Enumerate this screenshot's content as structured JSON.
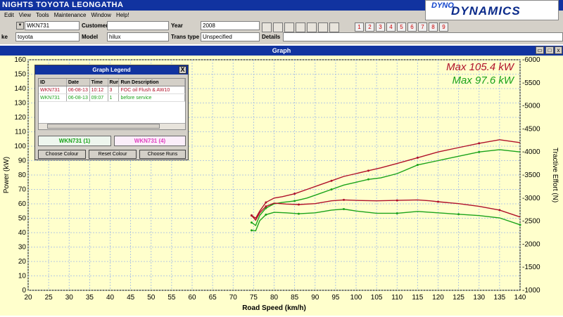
{
  "app": {
    "title": "NIGHTS TOYOTA LEONGATHA",
    "menu": [
      "Edit",
      "View",
      "Tools",
      "Maintenance",
      "Window",
      "Help!"
    ],
    "logo_top": "DYNO",
    "logo_main": "DYNAMICS"
  },
  "vehicle": {
    "rego_value": "WKN731",
    "customer_label": "Customer",
    "customer_value": "",
    "year_label": "Year",
    "year_value": "2008",
    "make_label": "ke",
    "make_value": "toyota",
    "model_label": "Model",
    "model_value": "hilux",
    "trans_label": "Trans type",
    "trans_value": "Unspecified",
    "details_label": "Details"
  },
  "toolbar": {
    "run_buttons": [
      "1",
      "2",
      "3",
      "4",
      "5",
      "6",
      "7",
      "8",
      "9"
    ]
  },
  "graph_window": {
    "title": "Graph"
  },
  "legend": {
    "title": "Graph Legend",
    "close": "X",
    "columns": [
      "ID",
      "Date",
      "Time",
      "Run",
      "Run Description"
    ],
    "rows": [
      {
        "id": "WKN731",
        "date": "06-08-13",
        "time": "10:12",
        "run": "3",
        "desc": "FOC oil Flush & AW10",
        "color": "#b0102a"
      },
      {
        "id": "WKN731",
        "date": "06-08-13",
        "time": "09:07",
        "run": "1",
        "desc": "before service",
        "color": "#1aa31a"
      }
    ],
    "run_boxes": [
      {
        "label": "WKN731 (1)",
        "color": "#1aa31a"
      },
      {
        "label": "WKN731 (4)",
        "color": "#e040c0"
      }
    ],
    "buttons": [
      "Choose Colour",
      "Reset Colour",
      "Choose Runs"
    ]
  },
  "chart_data": {
    "type": "line",
    "xlabel": "Road Speed (km/h)",
    "ylabel": "Power (kW)",
    "y2label": "Tractive Effort (N)",
    "xlim": [
      20,
      140
    ],
    "ylim": [
      0,
      160
    ],
    "y2lim": [
      1000,
      6000
    ],
    "xticks": [
      20,
      25,
      30,
      35,
      40,
      45,
      50,
      55,
      60,
      65,
      70,
      75,
      80,
      85,
      90,
      95,
      100,
      105,
      110,
      115,
      120,
      125,
      130,
      135,
      140
    ],
    "yticks": [
      0,
      10,
      20,
      30,
      40,
      50,
      60,
      70,
      80,
      90,
      100,
      110,
      120,
      130,
      140,
      150,
      160
    ],
    "y2ticks": [
      1000,
      1500,
      2000,
      2500,
      3000,
      3500,
      4000,
      4500,
      5000,
      5500,
      6000
    ],
    "grid": true,
    "annotations": [
      {
        "text": "Max 105.4 kW",
        "color": "#b0102a"
      },
      {
        "text": "Max 97.6 kW",
        "color": "#1aa31a"
      }
    ],
    "series": [
      {
        "axis": "power",
        "color": "#b0102a",
        "x": [
          74.5,
          75.5,
          76.5,
          78,
          80,
          82,
          85,
          88,
          91,
          94,
          97,
          100,
          103,
          106,
          110,
          115,
          120,
          125,
          130,
          135,
          140
        ],
        "y": [
          52,
          50,
          55,
          61,
          64,
          65,
          67,
          70,
          73,
          76,
          79,
          81,
          83,
          85,
          88,
          92,
          96,
          99,
          102,
          104.5,
          102.5
        ]
      },
      {
        "axis": "power",
        "color": "#1aa31a",
        "x": [
          74.5,
          75.5,
          76.5,
          78,
          80,
          82,
          85,
          88,
          91,
          94,
          97,
          100,
          103,
          106,
          110,
          115,
          120,
          125,
          130,
          135,
          140
        ],
        "y": [
          47,
          45,
          52,
          57,
          60,
          61,
          62,
          64,
          67,
          70,
          73,
          75,
          77,
          78,
          81,
          87,
          90,
          93,
          96,
          97.6,
          96
        ]
      },
      {
        "axis": "tractive",
        "color": "#b0102a",
        "x": [
          74.5,
          75.5,
          76.5,
          78,
          80,
          83,
          86,
          90,
          94,
          97,
          100,
          105,
          110,
          115,
          118,
          120,
          125,
          130,
          135,
          140
        ],
        "y": [
          2620,
          2520,
          2680,
          2820,
          2890,
          2870,
          2860,
          2880,
          2940,
          2960,
          2950,
          2940,
          2950,
          2960,
          2940,
          2920,
          2880,
          2820,
          2740,
          2590
        ]
      },
      {
        "axis": "tractive",
        "color": "#1aa31a",
        "x": [
          74.5,
          75.5,
          76.5,
          78,
          80,
          83,
          86,
          90,
          94,
          97,
          100,
          105,
          110,
          115,
          120,
          125,
          130,
          135,
          140
        ],
        "y": [
          2300,
          2290,
          2510,
          2640,
          2690,
          2680,
          2660,
          2680,
          2740,
          2760,
          2720,
          2670,
          2670,
          2710,
          2680,
          2650,
          2620,
          2570,
          2420
        ]
      }
    ]
  }
}
